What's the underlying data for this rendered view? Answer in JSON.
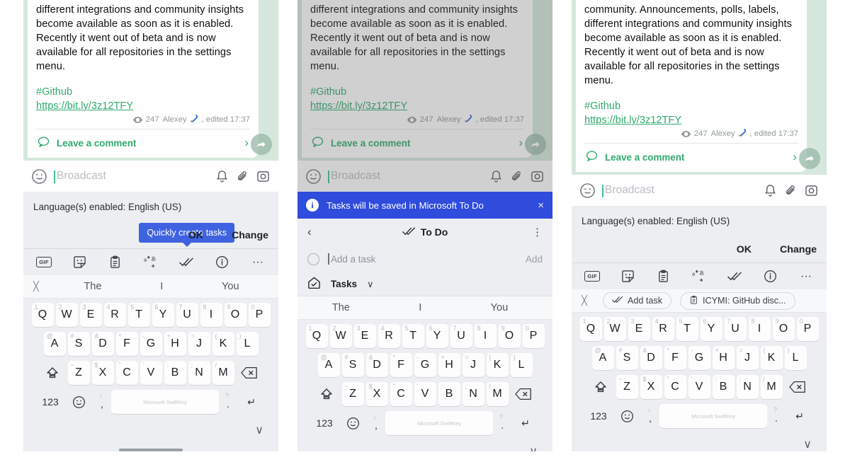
{
  "message": {
    "line_clipped": "community. Announcements, polls, labels,",
    "body": "different integrations and community insights become available as soon as it is enabled. Recently it went out of beta and is now available for all repositories in the settings menu.",
    "hashtag": "#Github",
    "link": "https://bit.ly/3z12TFY",
    "views": "247",
    "author": "Alexey",
    "edited": ", edited 17:37",
    "comment_label": "Leave a comment"
  },
  "compose": {
    "placeholder": "Broadcast",
    "icons": [
      "sticker-icon",
      "bell-icon",
      "paperclip-icon",
      "camera-icon"
    ]
  },
  "language_strip": {
    "text": "Language(s) enabled: English (US)",
    "ok_label": "OK",
    "change_label": "Change"
  },
  "tooltip": {
    "text": "Quickly create tasks"
  },
  "toolbar": {
    "items": [
      {
        "name": "gif-icon",
        "label": "GIF"
      },
      {
        "name": "sticker-icon",
        "label": ""
      },
      {
        "name": "clipboard-icon",
        "label": ""
      },
      {
        "name": "translate-icon",
        "label": ""
      },
      {
        "name": "tasks-checkmark-icon",
        "label": ""
      },
      {
        "name": "info-icon",
        "label": ""
      },
      {
        "name": "more-icon",
        "label": "···"
      }
    ]
  },
  "suggestions": {
    "close_label": "╳",
    "words": [
      "The",
      "I",
      "You"
    ],
    "chips": [
      {
        "icon": "tasks-checkmark-icon",
        "label": "Add task"
      },
      {
        "icon": "clipboard-icon",
        "label": "ICYMI: GitHub disc..."
      }
    ]
  },
  "notice": {
    "text": "Tasks will be saved in Microsoft To Do",
    "info_glyph": "i",
    "close_glyph": "×"
  },
  "todo": {
    "back_glyph": "‹",
    "title": "To Do",
    "kebab_glyph": "⋮",
    "add_placeholder": "Add a task",
    "add_button": "Add",
    "list_label": "Tasks",
    "list_chevron": "∨"
  },
  "keyboard": {
    "row1": [
      {
        "key": "Q",
        "sup": "1"
      },
      {
        "key": "W",
        "sup": "2"
      },
      {
        "key": "E",
        "sup": "3"
      },
      {
        "key": "R",
        "sup": "4"
      },
      {
        "key": "T",
        "sup": "5"
      },
      {
        "key": "Y",
        "sup": "6"
      },
      {
        "key": "U",
        "sup": "7"
      },
      {
        "key": "I",
        "sup": "8"
      },
      {
        "key": "O",
        "sup": "9"
      },
      {
        "key": "P",
        "sup": "0"
      }
    ],
    "row2": [
      {
        "key": "A",
        "sup": "@"
      },
      {
        "key": "S",
        "sup": "#"
      },
      {
        "key": "D",
        "sup": "&"
      },
      {
        "key": "F",
        "sup": "*"
      },
      {
        "key": "G",
        "sup": "-"
      },
      {
        "key": "H",
        "sup": "+"
      },
      {
        "key": "J",
        "sup": "="
      },
      {
        "key": "K",
        "sup": "("
      },
      {
        "key": "L",
        "sup": ")"
      }
    ],
    "row3": [
      {
        "key": "Z",
        "sup": "~"
      },
      {
        "key": "X",
        "sup": "$"
      },
      {
        "key": "C",
        "sup": "\""
      },
      {
        "key": "V",
        "sup": "'"
      },
      {
        "key": "B",
        "sup": ":"
      },
      {
        "key": "N",
        "sup": ";"
      },
      {
        "key": "M",
        "sup": "/"
      }
    ],
    "shift_glyph": "⇧",
    "backspace_glyph": "⌫",
    "numeric_label": "123",
    "emoji_glyph": "☺",
    "comma": {
      "key": ",",
      "sup": "↓"
    },
    "period": {
      "key": ".",
      "sup": "?"
    },
    "space_label": "Microsoft SwiftKey",
    "enter_glyph": "↵",
    "collapse_glyph": "∨"
  },
  "colors": {
    "chat_bg": "#d6e8dd",
    "accent_green": "#2faa6e",
    "notice_blue": "#2f4cdd",
    "tooltip_blue": "#3f62e0",
    "panel_bg": "#eceef1"
  }
}
